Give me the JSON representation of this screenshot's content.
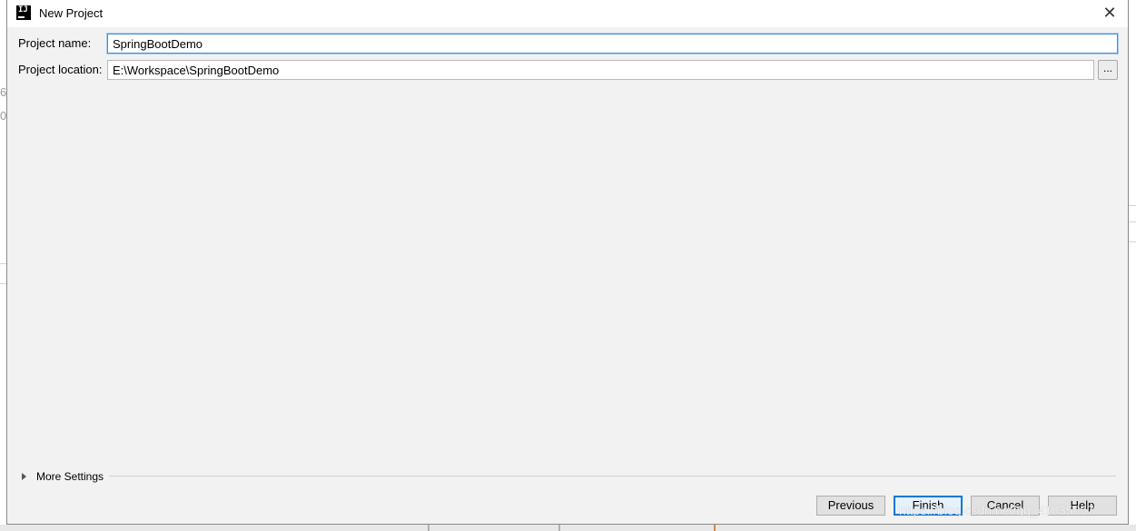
{
  "window": {
    "title": "New Project",
    "app_icon": "intellij-idea-icon",
    "close_glyph": "✕"
  },
  "form": {
    "project_name_label": "Project name:",
    "project_name_value": "SpringBootDemo",
    "project_location_label": "Project location:",
    "project_location_value": "E:\\Workspace\\SpringBootDemo",
    "browse_label": "..."
  },
  "more_settings": {
    "label": "More Settings",
    "expanded": false
  },
  "buttons": {
    "previous": "Previous",
    "finish": "Finish",
    "cancel": "Cancel",
    "help": "Help"
  },
  "background": {
    "glyph_a": "6",
    "glyph_b": "0,"
  },
  "watermark": "https://blog.csdn.net/qq_41835857",
  "colors": {
    "dialog_bg": "#f2f2f2",
    "focus_border": "#3d8ee0",
    "default_button_border": "#0078d7"
  }
}
